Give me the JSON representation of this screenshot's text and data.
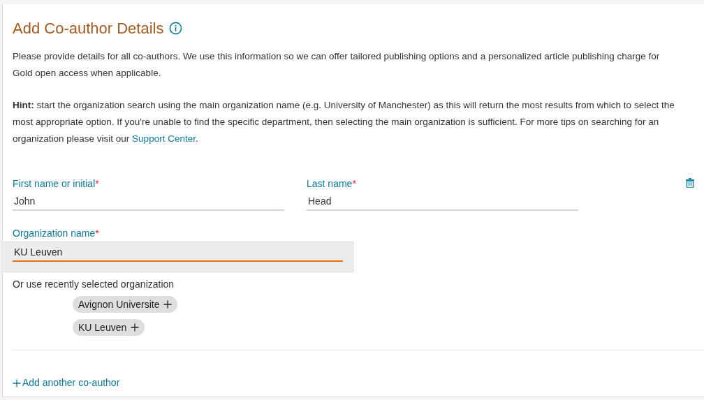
{
  "title": "Add Co-author Details",
  "intro": "Please provide details for all co-authors. We use this information so we can offer tailored publishing options and a personalized article publishing charge for Gold open access when applicable.",
  "hint": {
    "text": "**Hint:** start the organization search using the main organization name (e.g. University of Manchester) as this will return the most results from which to select the most appropriate option. If you're unable to find the specific department, then selecting the main organization is sufficient. For more tips on searching for an organization please visit our",
    "link": "Support Center",
    "after": "."
  },
  "name_fields": [
    {
      "label": "First name or initial",
      "required_mark": "*",
      "value": "John"
    },
    {
      "label": "Last name",
      "required_mark": "*",
      "value": "Head"
    }
  ],
  "organization": {
    "label": "Organization name",
    "required_mark": "*",
    "value": "KU Leuven",
    "focused": true
  },
  "recent": {
    "label": "Or use recently selected organization",
    "chips": [
      "Avignon Universite",
      "KU Leuven"
    ]
  },
  "add_link": "Add another co-author"
}
